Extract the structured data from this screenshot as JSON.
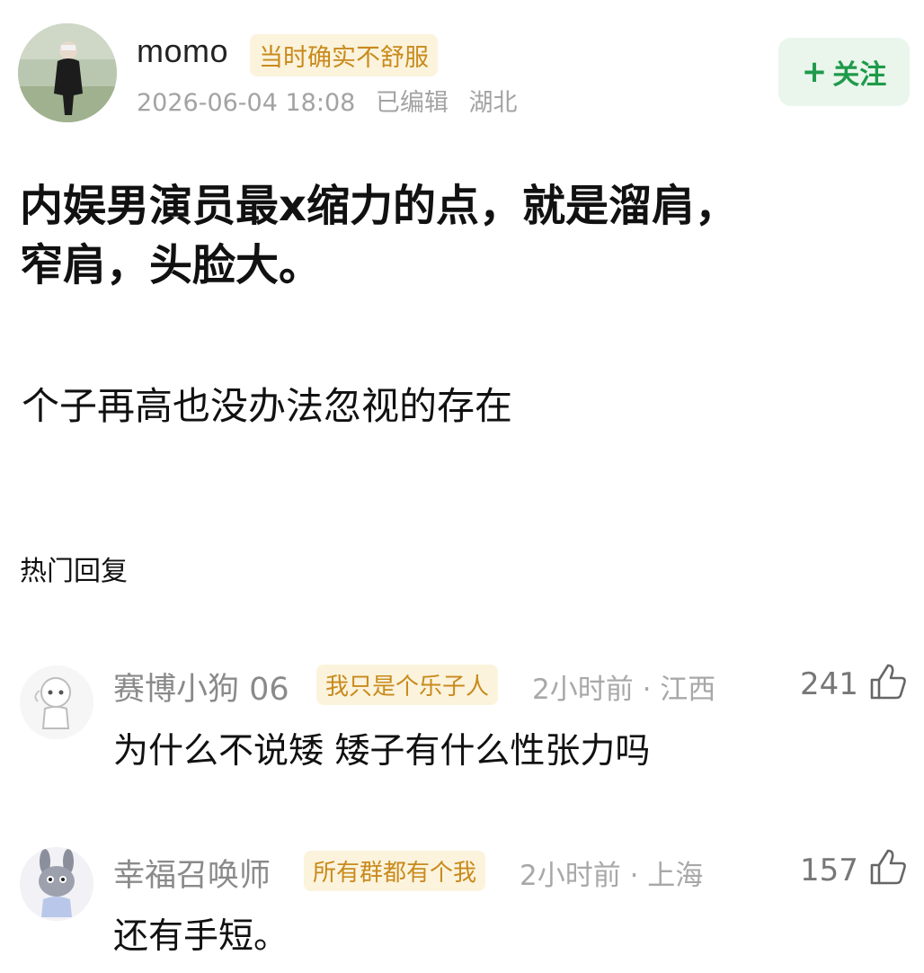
{
  "post": {
    "username": "momo",
    "user_tag": "当时确实不舒服",
    "date": "2026-06-04 18:08",
    "edited": "已编辑",
    "location": "湖北",
    "follow_label": "关注",
    "headline_line1": "内娱男演员最x缩力的点，就是溜肩，",
    "headline_line2": "窄肩，头脸大。",
    "body": "个子再高也没办法忽视的存在"
  },
  "replies_section": {
    "title": "热门回复",
    "comments": [
      {
        "name": "赛博小狗 06",
        "tag": "我只是个乐子人",
        "time": "2小时前 · 江西",
        "likes": "241",
        "text": "为什么不说矮 矮子有什么性张力吗"
      },
      {
        "name": "幸福召唤师",
        "tag": "所有群都有个我",
        "time": "2小时前 · 上海",
        "likes": "157",
        "text": "还有手短。"
      }
    ]
  },
  "colors": {
    "follow_green": "#1f9a4a",
    "follow_bg": "#eaf6ec",
    "tag_text": "#c98a1c",
    "tag_bg": "#fbf3dc"
  }
}
